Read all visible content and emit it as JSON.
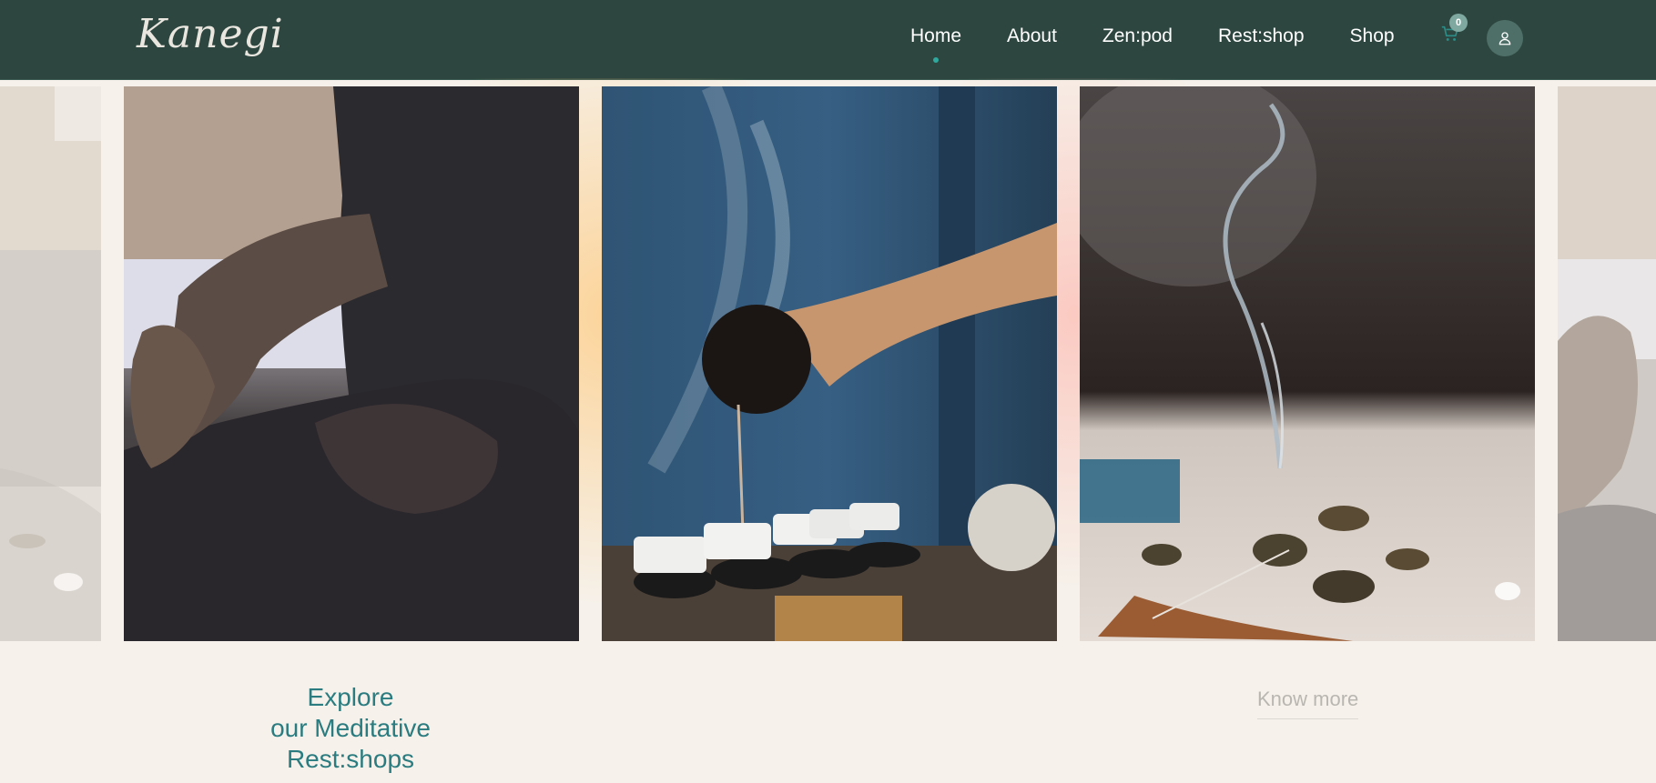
{
  "header": {
    "logo_text": "Kanegi",
    "nav": [
      {
        "label": "Home",
        "active": true
      },
      {
        "label": "About",
        "active": false
      },
      {
        "label": "Zen:pod",
        "active": false
      },
      {
        "label": "Rest:shop",
        "active": false
      },
      {
        "label": "Shop",
        "active": false
      }
    ],
    "cart": {
      "icon": "cart-icon",
      "count": "0"
    },
    "account": {
      "icon": "user-icon"
    }
  },
  "carousel": {
    "slides": [
      {
        "name": "meditation-pose-partial-left",
        "icon": "image"
      },
      {
        "name": "meditation-pose",
        "icon": "image"
      },
      {
        "name": "tea-pouring",
        "icon": "image"
      },
      {
        "name": "incense-smoke",
        "icon": "image"
      },
      {
        "name": "meditation-pose-partial-right",
        "icon": "image"
      }
    ]
  },
  "section": {
    "title_lines": [
      "Explore",
      "our Meditative",
      "Rest:shops"
    ],
    "link_label": "Know more"
  },
  "colors": {
    "header_bg": "#2d4740",
    "page_bg": "#f6f1ea",
    "accent_teal": "#2a7c80",
    "active_dot": "#2fa99e"
  }
}
